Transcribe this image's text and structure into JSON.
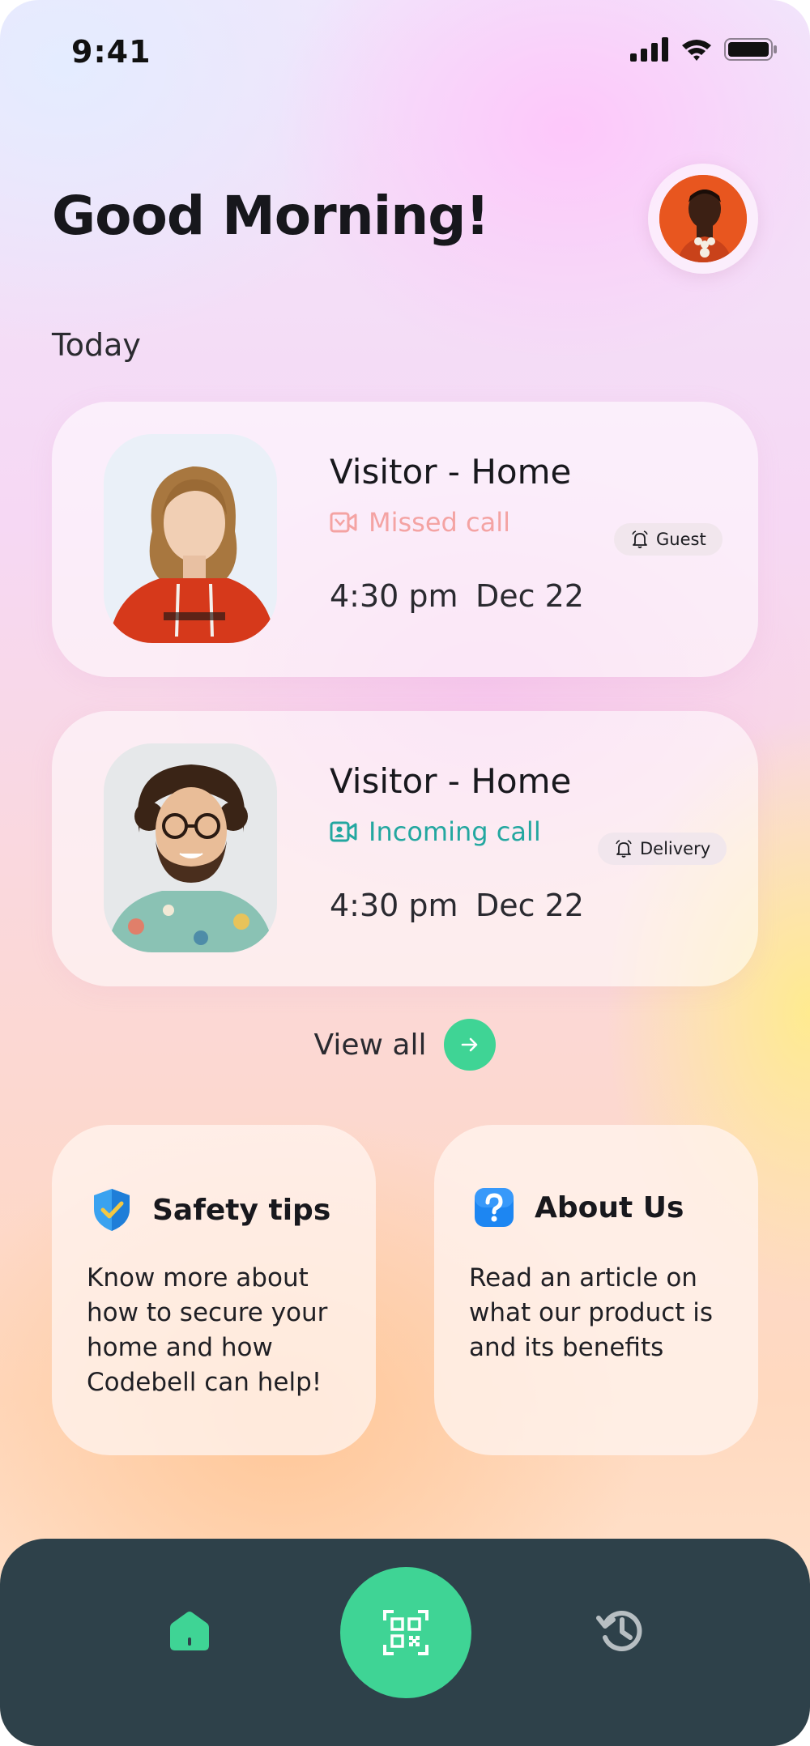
{
  "status_bar": {
    "time": "9:41"
  },
  "header": {
    "greeting": "Good Morning!"
  },
  "section": {
    "label": "Today"
  },
  "visits": [
    {
      "title": "Visitor - Home",
      "status": "Missed call",
      "time": "4:30 pm",
      "date": "Dec 22",
      "tag": "Guest"
    },
    {
      "title": "Visitor - Home",
      "status": "Incoming call",
      "time": "4:30 pm",
      "date": "Dec 22",
      "tag": "Delivery"
    }
  ],
  "view_all": {
    "label": "View all"
  },
  "info_cards": [
    {
      "title": "Safety tips",
      "body": "Know more about how to secure your home and how Codebell can help!",
      "icon": "shield-check-icon"
    },
    {
      "title": "About Us",
      "body": "Read an article on what our product is and its benefits",
      "icon": "question-icon"
    }
  ],
  "nav": {
    "items": [
      "home-icon",
      "qr-scan-icon",
      "history-icon"
    ]
  },
  "colors": {
    "accent": "#3fd495",
    "missed": "#f4a3a3",
    "incoming": "#23a7a0",
    "nav_bg": "#2e414a"
  }
}
